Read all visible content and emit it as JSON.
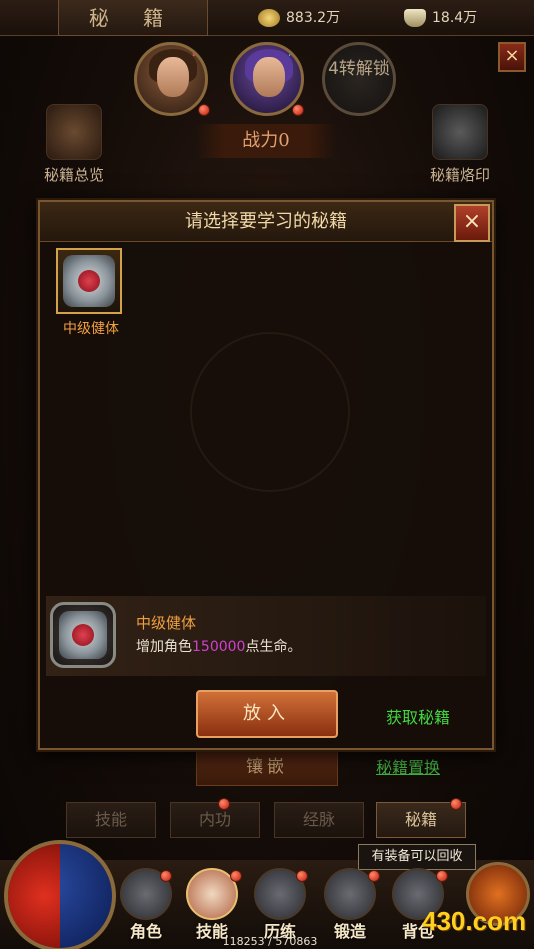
{
  "topbar": {
    "title": "秘 籍",
    "gold": "883.2万",
    "ingot": "18.4万",
    "close_label": "×"
  },
  "heroes": [
    {
      "tag": "战"
    },
    {
      "tag": "法"
    },
    {
      "lock_text": "4转解锁"
    }
  ],
  "side": {
    "left_label": "秘籍总览",
    "right_label": "秘籍烙印",
    "power_label": "战力0"
  },
  "dialog": {
    "title": "请选择要学习的秘籍",
    "close_label": "×",
    "item_label": "中级健体",
    "detail_name": "中级健体",
    "detail_desc_prefix": "增加角色",
    "detail_desc_value": "150000",
    "detail_desc_suffix": "点生命。",
    "put_button": "放入",
    "get_link": "获取秘籍"
  },
  "lower": {
    "inlay_button": "镶嵌",
    "swap_link": "秘籍置换"
  },
  "subtabs": [
    {
      "label": "技能"
    },
    {
      "label": "内功"
    },
    {
      "label": "经脉"
    },
    {
      "label": "秘籍"
    }
  ],
  "tooltip": "有装备可以回收",
  "nav": [
    {
      "label": "角色"
    },
    {
      "label": "技能"
    },
    {
      "label": "历练"
    },
    {
      "label": "锻造"
    },
    {
      "label": "背包"
    }
  ],
  "exp_text": "118253 / 570863",
  "watermark": "430.com"
}
